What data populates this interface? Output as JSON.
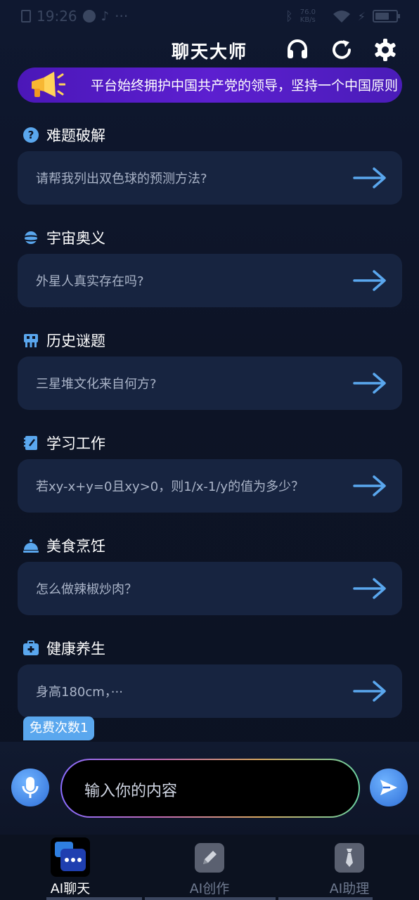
{
  "status_bar": {
    "time": "19:26",
    "more": "···",
    "net_speed": "76.0 KB/s",
    "battery": "68",
    "battery_level": 0.68
  },
  "header": {
    "title": "聊天大师"
  },
  "announcement": {
    "text": "平台始终拥护中国共产党的领导，坚持一个中国原则"
  },
  "sections": [
    {
      "label": "难题破解",
      "icon": "question-icon",
      "question": "请帮我列出双色球的预测方法?"
    },
    {
      "label": "宇宙奥义",
      "icon": "planet-icon",
      "question": "外星人真实存在吗?"
    },
    {
      "label": "历史谜题",
      "icon": "totem-icon",
      "question": "三星堆文化来自何方?"
    },
    {
      "label": "学习工作",
      "icon": "notebook-icon",
      "question": "若xy-x+y=0且xy>0，则1/x-1/y的值为多少？"
    },
    {
      "label": "美食烹饪",
      "icon": "cloche-icon",
      "question": "怎么做辣椒炒肉？"
    },
    {
      "label": "健康养生",
      "icon": "medkit-icon",
      "question": "身高180cm，···"
    }
  ],
  "free_badge": "免费次数1",
  "input": {
    "placeholder": "输入你的内容"
  },
  "tabs": [
    {
      "label": "AI聊天",
      "active": true
    },
    {
      "label": "AI创作",
      "active": false
    },
    {
      "label": "AI助理",
      "active": false
    }
  ],
  "colors": {
    "background": "#0d1426",
    "card": "#172440",
    "accent": "#5aa7ee",
    "marquee": "#5c1fd0"
  }
}
